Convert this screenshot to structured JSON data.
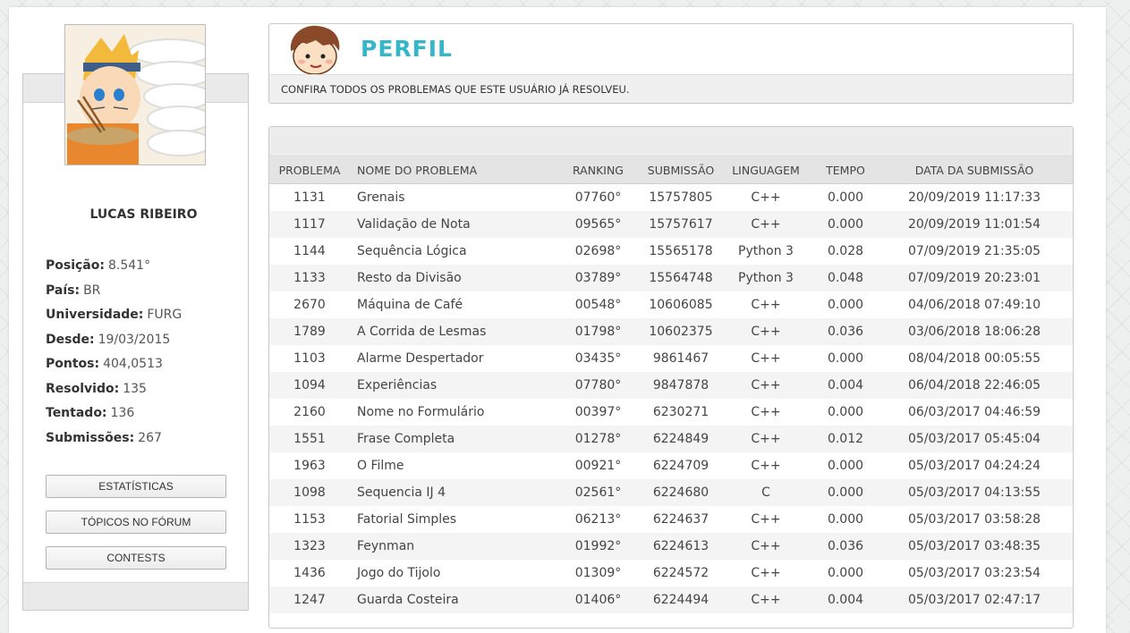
{
  "profile": {
    "name": "LUCAS RIBEIRO",
    "stats": [
      {
        "label": "Posição:",
        "value": "8.541°"
      },
      {
        "label": "País:",
        "value": "BR"
      },
      {
        "label": "Universidade:",
        "value": "FURG"
      },
      {
        "label": "Desde:",
        "value": "19/03/2015"
      },
      {
        "label": "Pontos:",
        "value": "404,0513"
      },
      {
        "label": "Resolvido:",
        "value": "135"
      },
      {
        "label": "Tentado:",
        "value": "136"
      },
      {
        "label": "Submissões:",
        "value": "267"
      }
    ],
    "buttons": {
      "stats": "ESTATÍSTICAS",
      "forum": "TÓPICOS NO FÓRUM",
      "contests": "CONTESTS"
    }
  },
  "header": {
    "title": "PERFIL",
    "subtitle": "CONFIRA TODOS OS PROBLEMAS QUE ESTE USUÁRIO JÁ RESOLVEU."
  },
  "table": {
    "columns": [
      "PROBLEMA",
      "NOME DO PROBLEMA",
      "RANKING",
      "SUBMISSÃO",
      "LINGUAGEM",
      "TEMPO",
      "DATA DA SUBMISSÃO"
    ],
    "rows": [
      [
        "1131",
        "Grenais",
        "07760°",
        "15757805",
        "C++",
        "0.000",
        "20/09/2019 11:17:33"
      ],
      [
        "1117",
        "Validação de Nota",
        "09565°",
        "15757617",
        "C++",
        "0.000",
        "20/09/2019 11:01:54"
      ],
      [
        "1144",
        "Sequência Lógica",
        "02698°",
        "15565178",
        "Python 3",
        "0.028",
        "07/09/2019 21:35:05"
      ],
      [
        "1133",
        "Resto da Divisão",
        "03789°",
        "15564748",
        "Python 3",
        "0.048",
        "07/09/2019 20:23:01"
      ],
      [
        "2670",
        "Máquina de Café",
        "00548°",
        "10606085",
        "C++",
        "0.000",
        "04/06/2018 07:49:10"
      ],
      [
        "1789",
        "A Corrida de Lesmas",
        "01798°",
        "10602375",
        "C++",
        "0.036",
        "03/06/2018 18:06:28"
      ],
      [
        "1103",
        "Alarme Despertador",
        "03435°",
        "9861467",
        "C++",
        "0.000",
        "08/04/2018 00:05:55"
      ],
      [
        "1094",
        "Experiências",
        "07780°",
        "9847878",
        "C++",
        "0.004",
        "06/04/2018 22:46:05"
      ],
      [
        "2160",
        "Nome no Formulário",
        "00397°",
        "6230271",
        "C++",
        "0.000",
        "06/03/2017 04:46:59"
      ],
      [
        "1551",
        "Frase Completa",
        "01278°",
        "6224849",
        "C++",
        "0.012",
        "05/03/2017 05:45:04"
      ],
      [
        "1963",
        "O Filme",
        "00921°",
        "6224709",
        "C++",
        "0.000",
        "05/03/2017 04:24:24"
      ],
      [
        "1098",
        "Sequencia IJ 4",
        "02561°",
        "6224680",
        "C",
        "0.000",
        "05/03/2017 04:13:55"
      ],
      [
        "1153",
        "Fatorial Simples",
        "06213°",
        "6224637",
        "C++",
        "0.000",
        "05/03/2017 03:58:28"
      ],
      [
        "1323",
        "Feynman",
        "01992°",
        "6224613",
        "C++",
        "0.036",
        "05/03/2017 03:48:35"
      ],
      [
        "1436",
        "Jogo do Tijolo",
        "01309°",
        "6224572",
        "C++",
        "0.000",
        "05/03/2017 03:23:54"
      ],
      [
        "1247",
        "Guarda Costeira",
        "01406°",
        "6224494",
        "C++",
        "0.004",
        "05/03/2017 02:47:17"
      ]
    ]
  },
  "colors": {
    "accent": "#36b7c9",
    "panel_bar": "#eaeaea",
    "row_stripe": "#f4f4f4"
  }
}
